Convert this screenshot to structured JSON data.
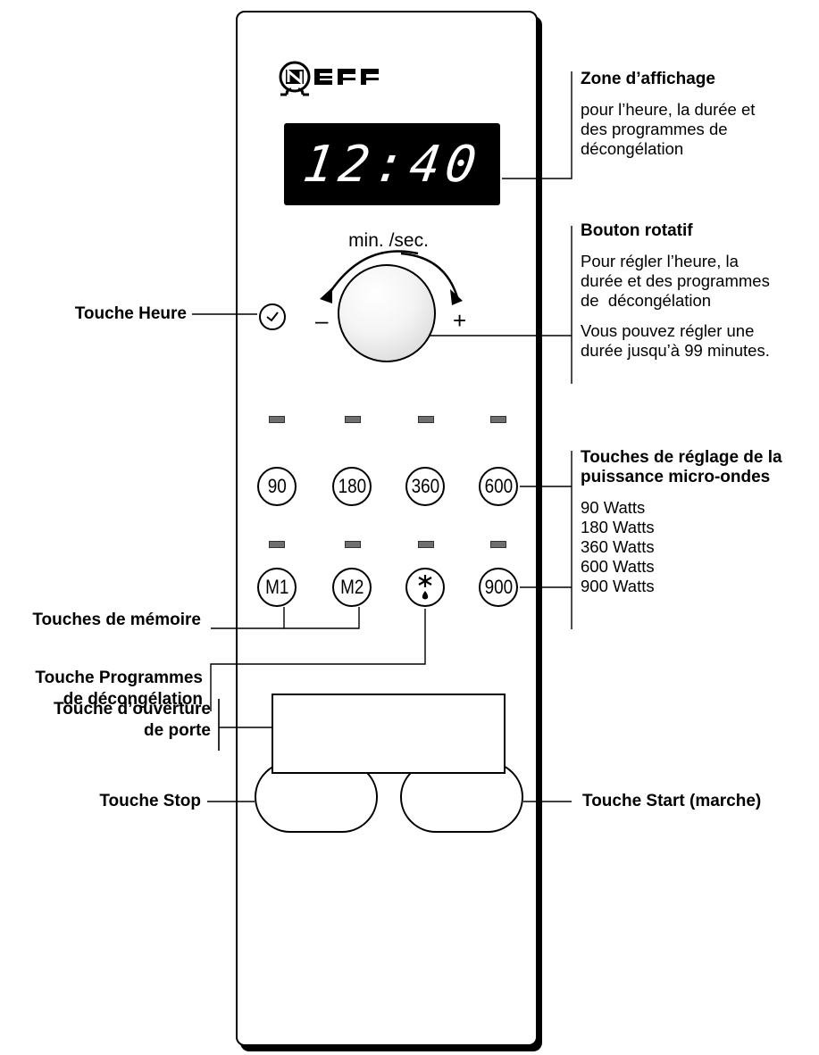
{
  "brand": "NEFF",
  "display": {
    "time": "12:40"
  },
  "knob": {
    "label": "min. /sec.",
    "minus": "–",
    "plus": "+"
  },
  "power_buttons": [
    "90",
    "180",
    "360",
    "600"
  ],
  "memory_buttons": [
    "M1",
    "M2"
  ],
  "defrost_symbol": "✱",
  "button_900": "900",
  "stop_label": "stop",
  "start_label": "start",
  "callouts": {
    "zone": {
      "title": "Zone d’affichage",
      "lines": [
        "pour l’heure, la durée et",
        "des programmes de",
        "décongélation"
      ]
    },
    "bouton": {
      "title": "Bouton rotatif",
      "lines_a": [
        "Pour régler l’heure, la",
        "durée et des programmes",
        "de  décongélation"
      ],
      "lines_b": [
        "Vous pouvez régler une",
        "durée jusqu’à 99 minutes."
      ]
    },
    "puissance": {
      "title_1": "Touches de réglage de la",
      "title_2": "puissance micro-ondes",
      "lines": [
        "90 Watts",
        "180 Watts",
        "360 Watts",
        "600 Watts",
        "900 Watts"
      ]
    }
  },
  "left_labels": {
    "heure": "Touche Heure",
    "memoire": "Touches de mémoire",
    "programmes_1": "Touche Programmes",
    "programmes_2": "de décongélation",
    "stop": "Touche Stop",
    "porte_1": "Touche d’ouverture",
    "porte_2": "de porte"
  },
  "right_labels": {
    "start": "Touche Start (marche)"
  }
}
